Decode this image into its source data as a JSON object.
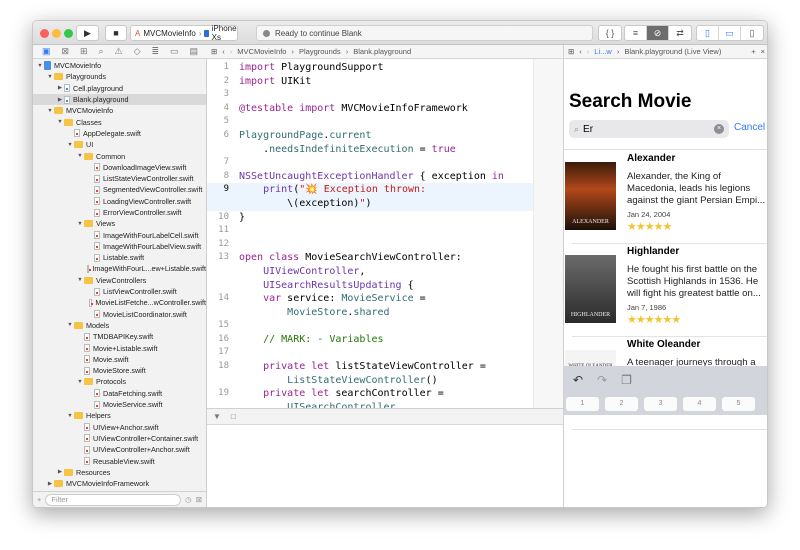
{
  "toolbar": {
    "scheme": "MVCMovieInfo",
    "device": "iPhone Xs",
    "status": "Ready to continue Blank",
    "run_icon": "play-icon",
    "stop_icon": "stop-icon"
  },
  "editor_jumpbar": [
    "MVCMovieInfo",
    "Playgrounds",
    "Blank.playground"
  ],
  "live_jumpbar": {
    "short": "Li...w",
    "file": "Blank.playground (Live View)"
  },
  "navigator": {
    "items": [
      {
        "label": "MVCMovieInfo",
        "depth": 0,
        "kind": "proj",
        "disc": "open"
      },
      {
        "label": "Playgrounds",
        "depth": 1,
        "kind": "folder",
        "disc": "open"
      },
      {
        "label": "Cell.playground",
        "depth": 2,
        "kind": "pg",
        "disc": "closed"
      },
      {
        "label": "Blank.playground",
        "depth": 2,
        "kind": "pg",
        "disc": "closed",
        "selected": true
      },
      {
        "label": "MVCMovieInfo",
        "depth": 1,
        "kind": "folder",
        "disc": "open"
      },
      {
        "label": "Classes",
        "depth": 2,
        "kind": "folder",
        "disc": "open"
      },
      {
        "label": "AppDelegate.swift",
        "depth": 3,
        "kind": "swift"
      },
      {
        "label": "UI",
        "depth": 3,
        "kind": "folder",
        "disc": "open"
      },
      {
        "label": "Common",
        "depth": 4,
        "kind": "folder",
        "disc": "open"
      },
      {
        "label": "DownloadImageView.swift",
        "depth": 5,
        "kind": "swift"
      },
      {
        "label": "ListStateViewController.swift",
        "depth": 5,
        "kind": "swift"
      },
      {
        "label": "SegmentedViewController.swift",
        "depth": 5,
        "kind": "swift"
      },
      {
        "label": "LoadingViewController.swift",
        "depth": 5,
        "kind": "swift"
      },
      {
        "label": "ErrorViewController.swift",
        "depth": 5,
        "kind": "swift"
      },
      {
        "label": "Views",
        "depth": 4,
        "kind": "folder",
        "disc": "open"
      },
      {
        "label": "ImageWithFourLabelCell.swift",
        "depth": 5,
        "kind": "swift"
      },
      {
        "label": "ImageWithFourLabelView.swift",
        "depth": 5,
        "kind": "swift"
      },
      {
        "label": "Listable.swift",
        "depth": 5,
        "kind": "swift"
      },
      {
        "label": "ImageWithFourL...ew+Listable.swift",
        "depth": 5,
        "kind": "swift"
      },
      {
        "label": "ViewControllers",
        "depth": 4,
        "kind": "folder",
        "disc": "open"
      },
      {
        "label": "ListViewController.swift",
        "depth": 5,
        "kind": "swift"
      },
      {
        "label": "MovieListFetche...wController.swift",
        "depth": 5,
        "kind": "swift"
      },
      {
        "label": "MovieListCoordinator.swift",
        "depth": 5,
        "kind": "swift"
      },
      {
        "label": "Models",
        "depth": 3,
        "kind": "folder",
        "disc": "open"
      },
      {
        "label": "TMDBAPIKey.swift",
        "depth": 4,
        "kind": "swift"
      },
      {
        "label": "Movie+Listable.swift",
        "depth": 4,
        "kind": "swift"
      },
      {
        "label": "Movie.swift",
        "depth": 4,
        "kind": "swift"
      },
      {
        "label": "MovieStore.swift",
        "depth": 4,
        "kind": "swift"
      },
      {
        "label": "Protocols",
        "depth": 4,
        "kind": "folder",
        "disc": "open"
      },
      {
        "label": "DataFetching.swift",
        "depth": 5,
        "kind": "swift"
      },
      {
        "label": "MovieService.swift",
        "depth": 5,
        "kind": "swift"
      },
      {
        "label": "Helpers",
        "depth": 3,
        "kind": "folder",
        "disc": "open"
      },
      {
        "label": "UIView+Anchor.swift",
        "depth": 4,
        "kind": "swift"
      },
      {
        "label": "UIViewController+Container.swift",
        "depth": 4,
        "kind": "swift"
      },
      {
        "label": "UIViewController+Anchor.swift",
        "depth": 4,
        "kind": "swift"
      },
      {
        "label": "ReusableView.swift",
        "depth": 4,
        "kind": "swift"
      },
      {
        "label": "Resources",
        "depth": 2,
        "kind": "folder",
        "disc": "closed"
      },
      {
        "label": "MVCMovieInfoFramework",
        "depth": 1,
        "kind": "folder",
        "disc": "closed"
      }
    ],
    "filter_placeholder": "Filter"
  },
  "code": [
    {
      "n": "1",
      "seg": [
        [
          "k",
          "import"
        ],
        [
          "p",
          " PlaygroundSupport"
        ]
      ]
    },
    {
      "n": "2",
      "seg": [
        [
          "k",
          "import"
        ],
        [
          "p",
          " UIKit"
        ]
      ]
    },
    {
      "n": "3",
      "seg": []
    },
    {
      "n": "4",
      "seg": [
        [
          "k",
          "@testable import"
        ],
        [
          "p",
          " MVCMovieInfoFramework"
        ]
      ]
    },
    {
      "n": "5",
      "seg": []
    },
    {
      "n": "6",
      "seg": [
        [
          "tl",
          "PlaygroundPage"
        ],
        [
          "p",
          "."
        ],
        [
          "tl",
          "current"
        ]
      ]
    },
    {
      "n": "",
      "seg": [
        [
          "p",
          "    ."
        ],
        [
          "tl",
          "needsIndefiniteExecution"
        ],
        [
          "p",
          " = "
        ],
        [
          "k",
          "true"
        ]
      ]
    },
    {
      "n": "7",
      "seg": []
    },
    {
      "n": "8",
      "seg": [
        [
          "ty",
          "NSSetUncaughtExceptionHandler"
        ],
        [
          "p",
          " { exception "
        ],
        [
          "k",
          "in"
        ]
      ]
    },
    {
      "n": "9",
      "cur": true,
      "seg": [
        [
          "p",
          "    "
        ],
        [
          "ty",
          "print"
        ],
        [
          "p",
          "("
        ],
        [
          "s",
          "\"💥 Exception thrown:"
        ]
      ]
    },
    {
      "n": "",
      "cur": true,
      "seg": [
        [
          "p",
          "        \\("
        ],
        [
          "p",
          "exception"
        ],
        [
          "p",
          ")"
        ],
        [
          "s",
          "\""
        ],
        [
          "p",
          ")"
        ]
      ]
    },
    {
      "n": "10",
      "seg": [
        [
          "p",
          "}"
        ]
      ]
    },
    {
      "n": "11",
      "seg": []
    },
    {
      "n": "12",
      "seg": []
    },
    {
      "n": "13",
      "seg": [
        [
          "k",
          "open class"
        ],
        [
          "p",
          " MovieSearchViewController:"
        ]
      ]
    },
    {
      "n": "",
      "seg": [
        [
          "p",
          "    "
        ],
        [
          "ty",
          "UIViewController"
        ],
        [
          "p",
          ","
        ]
      ]
    },
    {
      "n": "",
      "seg": [
        [
          "p",
          "    "
        ],
        [
          "ty",
          "UISearchResultsUpdating"
        ],
        [
          "p",
          " {"
        ]
      ]
    },
    {
      "n": "14",
      "seg": [
        [
          "p",
          "    "
        ],
        [
          "k",
          "var"
        ],
        [
          "p",
          " service: "
        ],
        [
          "tl",
          "MovieService"
        ],
        [
          "p",
          " ="
        ]
      ]
    },
    {
      "n": "",
      "seg": [
        [
          "p",
          "        "
        ],
        [
          "tl",
          "MovieStore"
        ],
        [
          "p",
          "."
        ],
        [
          "tl",
          "shared"
        ]
      ]
    },
    {
      "n": "15",
      "seg": []
    },
    {
      "n": "16",
      "seg": [
        [
          "p",
          "    "
        ],
        [
          "c",
          "// MARK: - Variables"
        ]
      ]
    },
    {
      "n": "17",
      "seg": []
    },
    {
      "n": "18",
      "seg": [
        [
          "p",
          "    "
        ],
        [
          "k",
          "private let"
        ],
        [
          "p",
          " listStateViewController ="
        ]
      ]
    },
    {
      "n": "",
      "seg": [
        [
          "p",
          "        "
        ],
        [
          "tl",
          "ListStateViewController"
        ],
        [
          "p",
          "()"
        ]
      ]
    },
    {
      "n": "19",
      "seg": [
        [
          "p",
          "    "
        ],
        [
          "k",
          "private let"
        ],
        [
          "p",
          " searchController ="
        ]
      ]
    },
    {
      "n": "",
      "seg": [
        [
          "p",
          "        "
        ],
        [
          "tl",
          "UISearchController"
        ]
      ]
    }
  ],
  "live_view": {
    "title": "Search Movie",
    "search_value": "Er",
    "cancel": "Cancel",
    "movies": [
      {
        "title": "Alexander",
        "desc": [
          "Alexander, the King of",
          "Macedonia, leads his legions",
          "against the giant Persian Empi..."
        ],
        "date": "Jan 24, 2004",
        "rating": 5,
        "poster_text": "ALEXANDER"
      },
      {
        "title": "Highlander",
        "desc": [
          "He fought his first battle on the",
          "Scottish Highlands in 1536. He",
          "will fight his greatest battle on..."
        ],
        "date": "Jan 7, 1986",
        "rating": 6,
        "poster_text": "HIGHLANDER"
      },
      {
        "title": "White Oleander",
        "desc": [
          "A teenager journeys through a"
        ],
        "poster_text": "WHITE OLEANDER"
      }
    ],
    "keys": [
      "1",
      "2",
      "3",
      "4",
      "5"
    ]
  }
}
